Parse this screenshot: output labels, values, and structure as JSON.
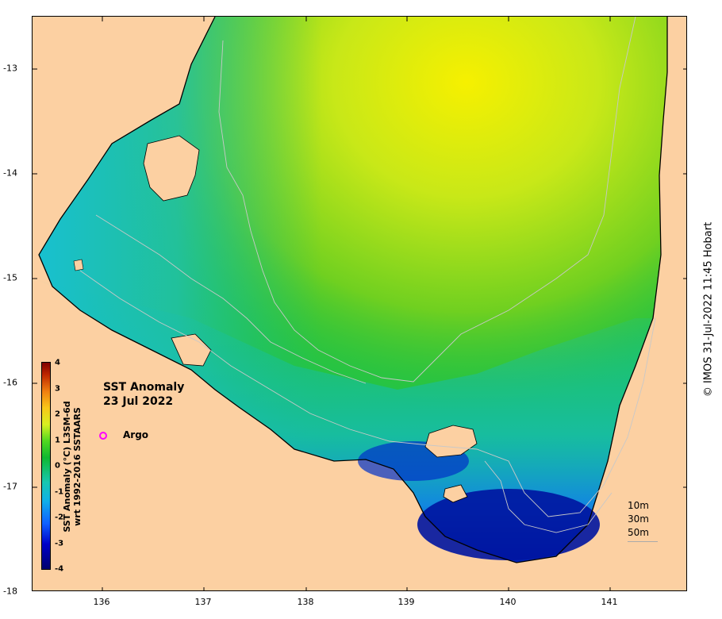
{
  "map": {
    "title_line1": "SST Anomaly",
    "title_line2": "23 Jul 2022",
    "legend_marker_label": "Argo",
    "colorbar_title_line1": "SST Anomaly (°C) L3SM-6d",
    "colorbar_title_line2": "wrt 1992-2016 SSTAARS",
    "colorbar_ticks": [
      "4",
      "3",
      "2",
      "1",
      "0",
      "-1",
      "-2",
      "-3",
      "-4"
    ],
    "longitude_ticks": [
      "136",
      "137",
      "138",
      "139",
      "140",
      "141"
    ],
    "latitude_ticks": [
      "-13",
      "-14",
      "-15",
      "-16",
      "-17",
      "-18"
    ],
    "depth_contours": [
      "10m",
      "30m",
      "50m"
    ],
    "credit": "© IMOS 31-Jul-2022 11:45 Hobart",
    "colors": {
      "land": "#fcd0a2",
      "argo_marker": "#ff00ff",
      "contour": "#c8c8c8"
    }
  }
}
